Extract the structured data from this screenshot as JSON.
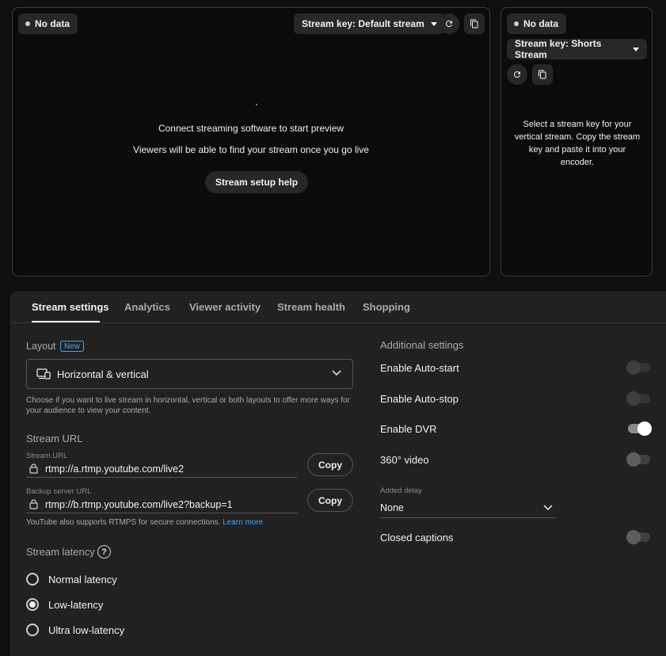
{
  "main_preview": {
    "status": "No data",
    "stream_key_label": "Stream key: Default stream",
    "connect_text": "Connect streaming software to start preview",
    "viewers_text": "Viewers will be able to find your stream once you go live",
    "setup_help_label": "Stream setup help"
  },
  "vertical_preview": {
    "status": "No data",
    "stream_key_label": "Stream key: Shorts Stream",
    "description": "Select a stream key for your vertical stream. Copy the stream key and paste it into your encoder."
  },
  "tabs": [
    {
      "label": "Stream settings",
      "active": true
    },
    {
      "label": "Analytics"
    },
    {
      "label": "Viewer activity"
    },
    {
      "label": "Stream health"
    },
    {
      "label": "Shopping"
    }
  ],
  "layout": {
    "label": "Layout",
    "badge": "New",
    "selected": "Horizontal & vertical",
    "description": "Choose if you want to live stream in horizontal, vertical or both layouts to offer more ways for your audience to view your content."
  },
  "stream_url": {
    "title": "Stream URL",
    "primary_label": "Stream URL",
    "primary_value": "rtmp://a.rtmp.youtube.com/live2",
    "backup_label": "Backup server URL",
    "backup_value": "rtmp://b.rtmp.youtube.com/live2?backup=1",
    "copy_label": "Copy",
    "note": "YouTube also supports RTMPS for secure connections.",
    "learn_more": "Learn more"
  },
  "latency": {
    "title": "Stream latency",
    "options": [
      {
        "label": "Normal latency",
        "selected": false
      },
      {
        "label": "Low-latency",
        "selected": true
      },
      {
        "label": "Ultra low-latency",
        "selected": false
      }
    ]
  },
  "additional": {
    "title": "Additional settings",
    "auto_start": {
      "label": "Enable Auto-start",
      "on": false
    },
    "auto_stop": {
      "label": "Enable Auto-stop",
      "on": false
    },
    "dvr": {
      "label": "Enable DVR",
      "on": true
    },
    "video_360": {
      "label": "360° video",
      "on": false
    },
    "delay_label": "Added delay",
    "delay_value": "None",
    "captions": {
      "label": "Closed captions",
      "on": false
    }
  },
  "colors": {
    "accent": "#3ea6ff",
    "surface": "#212121",
    "background": "#0f0f0f"
  }
}
